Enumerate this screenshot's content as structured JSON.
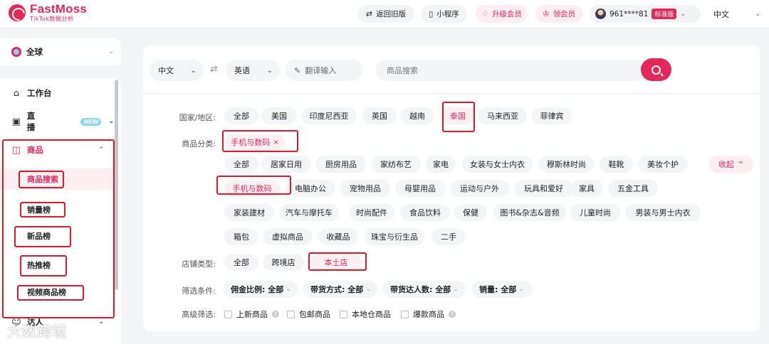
{
  "brand": {
    "name": "FastMoss",
    "sub": "TikTok数据分析"
  },
  "topbar": {
    "back_old": "返回旧版",
    "miniprogram": "小程序",
    "upgrade": "升级会员",
    "get_member": "领会员",
    "user_phone": "961****81",
    "plan_badge": "标准版",
    "language": "中文"
  },
  "sidebar": {
    "region": "全球",
    "workbench": "工作台",
    "live": "直播",
    "live_badge": "NEW",
    "product": "商品",
    "sub_items": [
      "商品搜索",
      "销量榜",
      "新品榜",
      "热推榜",
      "视频商品榜"
    ],
    "influencer": "达人"
  },
  "search": {
    "source_lang": "中文",
    "target_lang": "英语",
    "translate_placeholder": "翻译输入",
    "product_placeholder": "商品搜索"
  },
  "filters": {
    "country_label": "国家/地区:",
    "countries": [
      "全部",
      "美国",
      "印度尼西亚",
      "英国",
      "越南",
      "泰国",
      "马来西亚",
      "菲律宾"
    ],
    "category_label": "商品分类:",
    "selected_category": "手机与数码",
    "categories_row1": [
      "全部",
      "居家日用",
      "厨房用品",
      "家纺布艺",
      "家电",
      "女装与女士内衣",
      "穆斯林时尚",
      "鞋靴",
      "美妆个护"
    ],
    "categories_row2": [
      "手机与数码",
      "电脑办公",
      "宠物用品",
      "母婴用品",
      "运动与户外",
      "玩具和爱好",
      "家具",
      "五金工具"
    ],
    "categories_row3": [
      "家装建材",
      "汽车与摩托车",
      "时尚配件",
      "食品饮料",
      "保健",
      "图书&杂志&音频",
      "儿童时尚",
      "男装与男士内衣"
    ],
    "categories_row4": [
      "箱包",
      "虚拟商品",
      "收藏品",
      "珠宝与衍生品",
      "二手"
    ],
    "collapse": "收起",
    "shop_label": "店铺类型:",
    "shop_types": [
      "全部",
      "跨境店",
      "本土店"
    ],
    "condition_label": "筛选条件:",
    "conditions": [
      "佣金比例: 全部",
      "带货方式: 全部",
      "带货达人数: 全部",
      "销量: 全部"
    ],
    "advanced_label": "高级筛选:",
    "advanced": [
      "上新商品",
      "包邮商品",
      "本地仓商品",
      "爆款商品"
    ]
  },
  "watermark": "大数跨境",
  "colors": {
    "accent": "#e5285c",
    "highlight_box": "#e0182f"
  }
}
